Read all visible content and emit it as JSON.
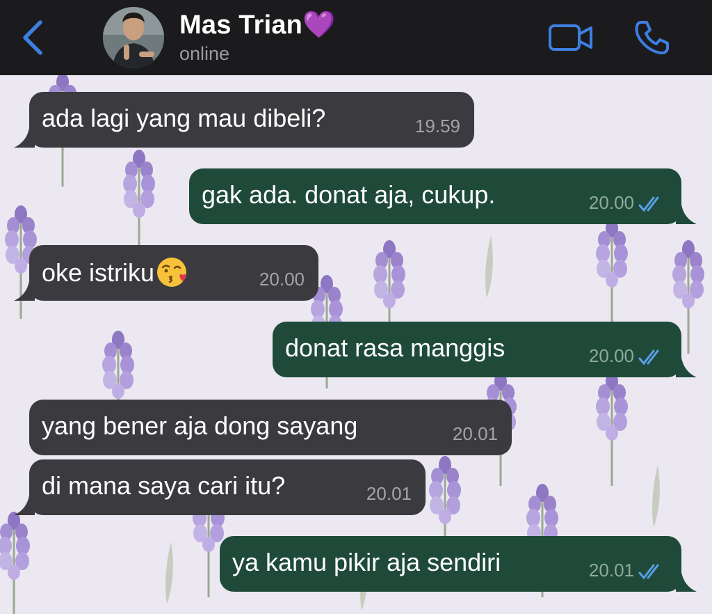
{
  "header": {
    "back_icon": "chevron-left-icon",
    "contact_name": "Mas Trian💜",
    "status": "online",
    "video_call_icon": "video-camera-icon",
    "voice_call_icon": "phone-icon",
    "accent_color": "#3d7fe0"
  },
  "chat": {
    "messages": [
      {
        "direction": "incoming",
        "text": "ada lagi yang mau dibeli?",
        "time": "19.59"
      },
      {
        "direction": "outgoing",
        "text": "gak ada. donat aja, cukup.",
        "time": "20.00",
        "status": "read"
      },
      {
        "direction": "incoming",
        "text": "oke istriku",
        "emoji": "😘",
        "time": "20.00"
      },
      {
        "direction": "outgoing",
        "text": "donat rasa manggis",
        "time": "20.00",
        "status": "read"
      },
      {
        "direction": "incoming",
        "text": "yang bener aja dong sayang",
        "time": "20.01"
      },
      {
        "direction": "incoming",
        "text": "di mana saya cari itu?",
        "time": "20.01"
      },
      {
        "direction": "outgoing",
        "text": "ya kamu pikir aja sendiri",
        "time": "20.01",
        "status": "read"
      }
    ],
    "incoming_color": "#3b3a3e",
    "outgoing_color": "#1f4a3a",
    "read_tick_color": "#5aa0e8",
    "wallpaper": "lavender floral pattern"
  }
}
